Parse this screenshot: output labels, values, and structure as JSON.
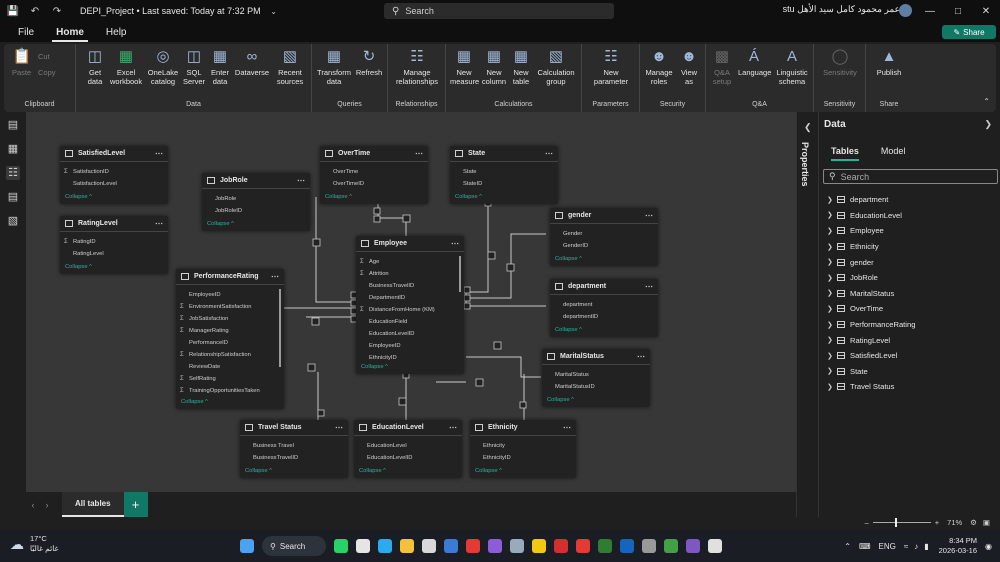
{
  "window": {
    "title": "DEPI_Project • Last saved: Today at 7:32 PM",
    "search_placeholder": "Search",
    "user_name": "عمر محمود كامل سيد الأهل stu",
    "menu_tabs": [
      "File",
      "Home",
      "Help"
    ],
    "active_menu_tab": "Home",
    "share_label": "Share"
  },
  "ribbon": {
    "groups": [
      {
        "label": "Clipboard",
        "buttons": [
          "Paste"
        ],
        "small": [
          "Cut",
          "Copy"
        ]
      },
      {
        "label": "Data",
        "buttons": [
          "Get data",
          "Excel workbook",
          "OneLake catalog",
          "SQL Server",
          "Enter data",
          "Dataverse",
          "Recent sources"
        ]
      },
      {
        "label": "Queries",
        "buttons": [
          "Transform data",
          "Refresh"
        ]
      },
      {
        "label": "Relationships",
        "buttons": [
          "Manage relationships"
        ]
      },
      {
        "label": "Calculations",
        "buttons": [
          "New measure",
          "New column",
          "New table",
          "Calculation group"
        ]
      },
      {
        "label": "Parameters",
        "buttons": [
          "New parameter"
        ]
      },
      {
        "label": "Security",
        "buttons": [
          "Manage roles",
          "View as"
        ]
      },
      {
        "label": "Q&A",
        "buttons": [
          "Q&A setup",
          "Language",
          "Linguistic schema"
        ]
      },
      {
        "label": "Sensitivity",
        "buttons": [
          "Sensitivity"
        ]
      },
      {
        "label": "Share",
        "buttons": [
          "Publish"
        ]
      }
    ]
  },
  "model_tables": {
    "satisfied": {
      "name": "SatisfiedLevel",
      "fields": [
        "SatisfactionID",
        "SatisfactionLevel"
      ]
    },
    "rating": {
      "name": "RatingLevel",
      "fields": [
        "RatingID",
        "RatingLevel"
      ]
    },
    "jobrole": {
      "name": "JobRole",
      "fields": [
        "JobRole",
        "JobRoleID"
      ]
    },
    "overtime": {
      "name": "OverTime",
      "fields": [
        "OverTime",
        "OverTimeID"
      ]
    },
    "state": {
      "name": "State",
      "fields": [
        "State",
        "StateID"
      ]
    },
    "gender": {
      "name": "gender",
      "fields": [
        "Gender",
        "GenderID"
      ]
    },
    "department": {
      "name": "department",
      "fields": [
        "department",
        "departmentID"
      ]
    },
    "marital": {
      "name": "MaritalStatus",
      "fields": [
        "MaritalStatus",
        "MaritalStatusID"
      ]
    },
    "employee": {
      "name": "Employee",
      "fields": [
        "Age",
        "Attrition",
        "BusinessTravelID",
        "DepartmentID",
        "DistanceFromHome (KM)",
        "EducationField",
        "EducationLevelID",
        "EmployeeID",
        "EthnicityID"
      ]
    },
    "perf": {
      "name": "PerformanceRating",
      "fields": [
        "EmployeeID",
        "EnvironmentSatisfaction",
        "JobSatisfaction",
        "ManagerRating",
        "PerformanceID",
        "RelationshipSatisfaction",
        "ReviewDate",
        "SelfRating",
        "TrainingOpportunitiesTaken"
      ]
    },
    "travel": {
      "name": "Travel Status",
      "fields": [
        "Business Travel",
        "BusinessTravelID"
      ]
    },
    "education": {
      "name": "EducationLevel",
      "fields": [
        "EducationLevel",
        "EducationLevelID"
      ]
    },
    "ethnicity": {
      "name": "Ethnicity",
      "fields": [
        "Ethnicity",
        "EthnicityID"
      ]
    },
    "collapse_label": "Collapse ^"
  },
  "page_tabs": {
    "active": "All tables",
    "add": "+"
  },
  "properties_pane": {
    "label": "Properties"
  },
  "data_pane": {
    "title": "Data",
    "tabs": [
      "Tables",
      "Model"
    ],
    "search_placeholder": "Search",
    "tables": [
      "department",
      "EducationLevel",
      "Employee",
      "Ethnicity",
      "gender",
      "JobRole",
      "MaritalStatus",
      "OverTime",
      "PerformanceRating",
      "RatingLevel",
      "SatisfiedLevel",
      "State",
      "Travel Status"
    ]
  },
  "status": {
    "zoom": "71%",
    "zoom_fraction": 0.38
  },
  "taskbar": {
    "temperature": "17°C",
    "weather_text": "غائم غالبًا",
    "search_label": "Search",
    "language": "ENG",
    "time": "8:34 PM",
    "date": "2026-03-16"
  }
}
